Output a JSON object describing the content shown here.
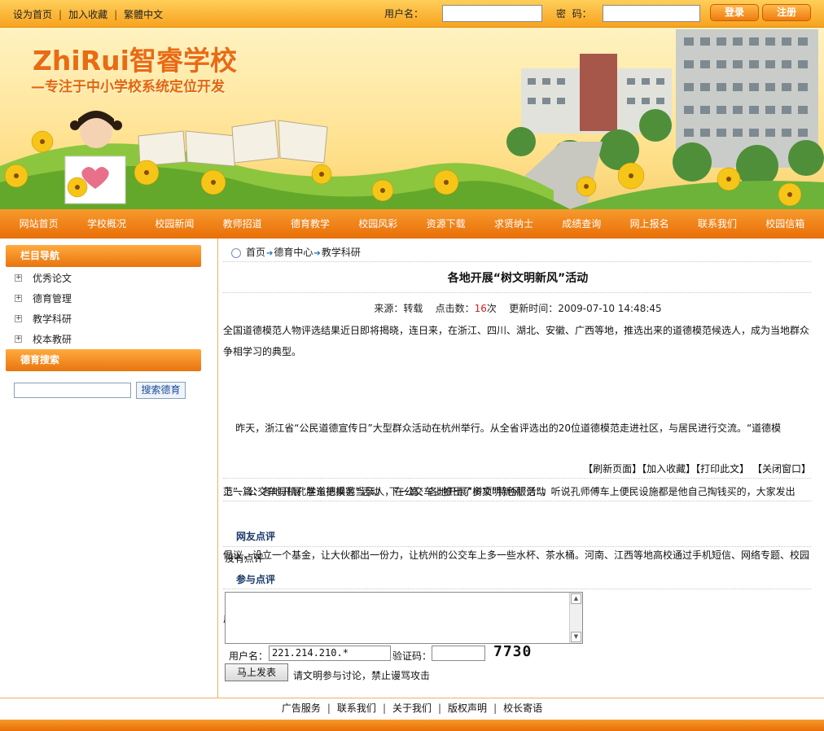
{
  "topbar": {
    "links": [
      "设为首页",
      "加入收藏",
      "繁體中文"
    ],
    "username_label": "用户名：",
    "password_label": "密  码：",
    "login_label": "登录",
    "register_label": "注册"
  },
  "banner": {
    "logo_en": "ZhiRui",
    "logo_cn": "智睿学校",
    "slogan": "—专注于中小学校系统定位开发"
  },
  "nav": [
    "网站首页",
    "学校概况",
    "校园新闻",
    "教师招道",
    "德育教学",
    "校园风彩",
    "资源下载",
    "求贤纳士",
    "成绩查询",
    "网上报名",
    "联系我们",
    "校园信箱"
  ],
  "sidebar": {
    "nav_title": "栏目导航",
    "items": [
      "优秀论文",
      "德育管理",
      "教学科研",
      "校本教研"
    ],
    "search_title": "德育搜索",
    "search_button": "搜索德育"
  },
  "breadcrumb": [
    "首页",
    "德育中心",
    "教学科研"
  ],
  "article": {
    "title": "各地开展“树文明新风”活动",
    "source_label": "来源：",
    "source": "转载",
    "hits_label": "点击数：",
    "hits": "16",
    "hits_unit": "次",
    "updated_label": "更新时间：",
    "updated": "2009-07-10 14:48:45",
    "para1_line1": "全国道德模范人物评选结果近日即将揭晓，连日来，在浙江、四川、湖北、安徽、广西等地，推选出来的道德模范候选人，成为当地群众",
    "para1_line2": "争相学习的典型。",
    "para2_line1": "    昨天，浙江省“公民道德宣传日”大型群众活动在杭州举行。从全省评选出的20位道德模范走进社区，与居民进行交流。“道德模",
    "para2_line2": "范”、公交车司机孔胜东把乘客当亲人，在公交车上推出了多项“特色服务”，听说孔师傅车上便民设施都是他自己掏钱买的，大家发出",
    "para2_line3": "倡议，设立一个基金，让大伙都出一份力，让杭州的公交车上多一些水杯、茶水桶。河南、江西等地高校通过手机短信、网络专题、校园",
    "para2_line4": "广播等形式广泛宣传道德模范的先进事迹。"
  },
  "tools": "【刷新页面】【加入收藏】【打印此文】 【关闭窗口】",
  "prevnext": {
    "prev_label": "上一篇：",
    "prev": "各地开展“学道德模范”活动",
    "next_label": "下一篇：",
    "next": "各地开展“树文明新风”活动"
  },
  "comments": {
    "title": "网友点评",
    "empty": "没有点评",
    "post_title": "参与点评",
    "username_label": "用户名：",
    "username_value": "221.214.210.*",
    "code_label": "验证码：",
    "captcha": "7730",
    "submit_label": "马上发表",
    "note": "请文明参与讨论，禁止谩骂攻击"
  },
  "footer": [
    "广告服务",
    "联系我们",
    "关于我们",
    "版权声明",
    "校长寄语"
  ],
  "colors": {
    "accent": "#f0820f",
    "nav_text": "#ffffff",
    "hits": "#d02020"
  }
}
